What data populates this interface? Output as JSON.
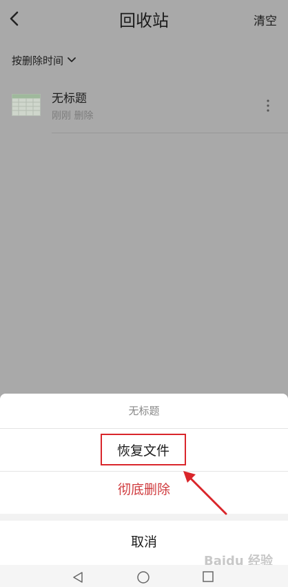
{
  "header": {
    "title": "回收站",
    "clear_label": "清空"
  },
  "sort": {
    "label": "按删除时间"
  },
  "files": [
    {
      "name": "无标题",
      "meta": "刚刚 删除"
    }
  ],
  "action_sheet": {
    "title": "无标题",
    "restore_label": "恢复文件",
    "delete_label": "彻底删除",
    "cancel_label": "取消"
  },
  "watermark": {
    "text": "Baidu 经验"
  },
  "colors": {
    "highlight_box": "#d9252a",
    "danger_text": "#cf3a3d"
  },
  "icons": [
    "back-icon",
    "chevron-down-icon",
    "spreadsheet-icon",
    "more-vertical-icon",
    "arrow-annotation",
    "nav-back-icon",
    "nav-home-icon",
    "nav-recent-icon"
  ]
}
